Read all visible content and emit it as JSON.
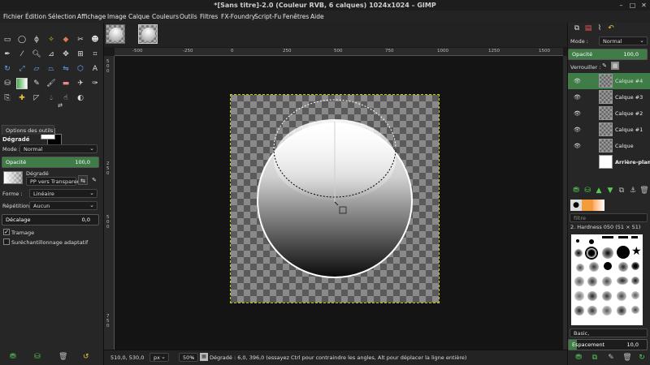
{
  "window": {
    "title": "*[Sans titre]-2.0 (Couleur RVB, 6 calques) 1024x1024 – GIMP",
    "minimize": "–",
    "maximize": "□",
    "close": "✕"
  },
  "menu": [
    "Fichier",
    "Édition",
    "Sélection",
    "Affichage",
    "Image",
    "Calque",
    "Couleurs",
    "Outils",
    "Filtres",
    "FX-Foundry",
    "Script-Fu",
    "Fenêtres",
    "Aide"
  ],
  "toolbox": {
    "tab_label": "Options des outils",
    "tool_name": "Dégradé",
    "mode_label": "Mode :",
    "mode_value": "Normal",
    "opacity_label": "Opacité",
    "opacity_value": "100,0",
    "opacity": 1.0,
    "gradient_label": "Dégradé",
    "gradient_name": "PP vers Transparent",
    "shape_label": "Forme :",
    "shape_value": "Linéaire",
    "repeat_label": "Répétition :",
    "repeat_value": "Aucun",
    "offset_label": "Décalage",
    "offset_value": "0,0",
    "dither_label": "Tramage",
    "dither_checked": true,
    "supersampling_label": "Suréchantillonnage adaptatif",
    "supersampling_checked": false
  },
  "rulers": {
    "horizontal": [
      "-500",
      "-250",
      "0",
      "250",
      "500",
      "750",
      "1000",
      "1250",
      "1500"
    ],
    "vertical": [
      "5",
      "0",
      "0",
      "2",
      "5",
      "0",
      "5",
      "0",
      "0",
      "7",
      "5",
      "0"
    ]
  },
  "status": {
    "coords": "510,0, 530,0",
    "unit": "px",
    "zoom": "50%",
    "message": "Dégradé : 6,0, 396,0 (essayez Ctrl pour contraindre les angles, Alt pour déplacer la ligne entière)"
  },
  "layers_panel": {
    "mode_label": "Mode :",
    "mode_value": "Normal",
    "opacity_label": "Opacité",
    "opacity_value": "100,0",
    "opacity": 1.0,
    "lock_label": "Verrouiller :",
    "layers": [
      {
        "name": "Calque #4",
        "selected": true
      },
      {
        "name": "Calque #3",
        "selected": false
      },
      {
        "name": "Calque #2",
        "selected": false
      },
      {
        "name": "Calque #1",
        "selected": false
      },
      {
        "name": "Calque",
        "selected": false
      },
      {
        "name": "Arrière-plan",
        "selected": false
      }
    ]
  },
  "brushes_panel": {
    "filter_placeholder": "filtre",
    "brush_name": "2. Hardness 050 (51 × 51)",
    "tag_value": "Basic,",
    "spacing_label": "Espacement",
    "spacing_value": "10,0",
    "spacing": 0.1
  },
  "colors": {
    "accent": "#3f7c48",
    "background": "#1a1a1a",
    "panel": "#262626",
    "selection_marching": "#c8c800"
  }
}
